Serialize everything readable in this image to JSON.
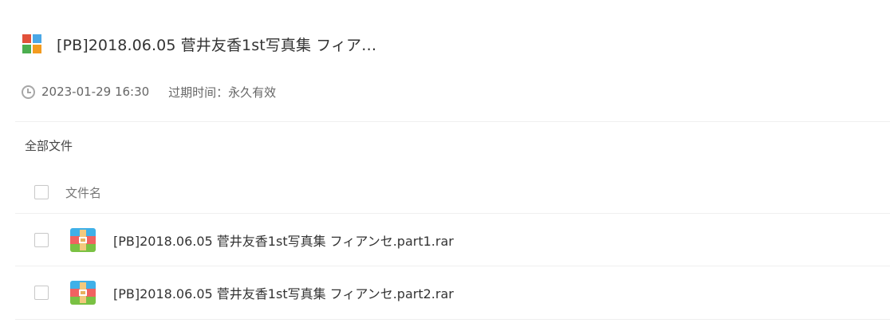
{
  "share": {
    "title": "[PB]2018.06.05 菅井友香1st写真集 フィア…",
    "icon": "share-grid-icon",
    "icon_colors": [
      "#e74c3c",
      "#3498db",
      "#2ecc71",
      "#f39c12"
    ]
  },
  "meta": {
    "icon": "clock-icon",
    "timestamp": "2023-01-29 16:30",
    "expire": "过期时间：永久有效"
  },
  "breadcrumb": {
    "label": "全部文件"
  },
  "table": {
    "column_header": "文件名",
    "rows": [
      {
        "icon": "rar-archive-icon",
        "name": "[PB]2018.06.05 菅井友香1st写真集 フィアンセ.part1.rar"
      },
      {
        "icon": "rar-archive-icon",
        "name": "[PB]2018.06.05 菅井友香1st写真集 フィアンセ.part2.rar"
      }
    ]
  },
  "colors": {
    "rar_top": "#3fb0e8",
    "rar_middle": "#f06261",
    "rar_bottom": "#7ac143",
    "divider": "#efefef"
  }
}
